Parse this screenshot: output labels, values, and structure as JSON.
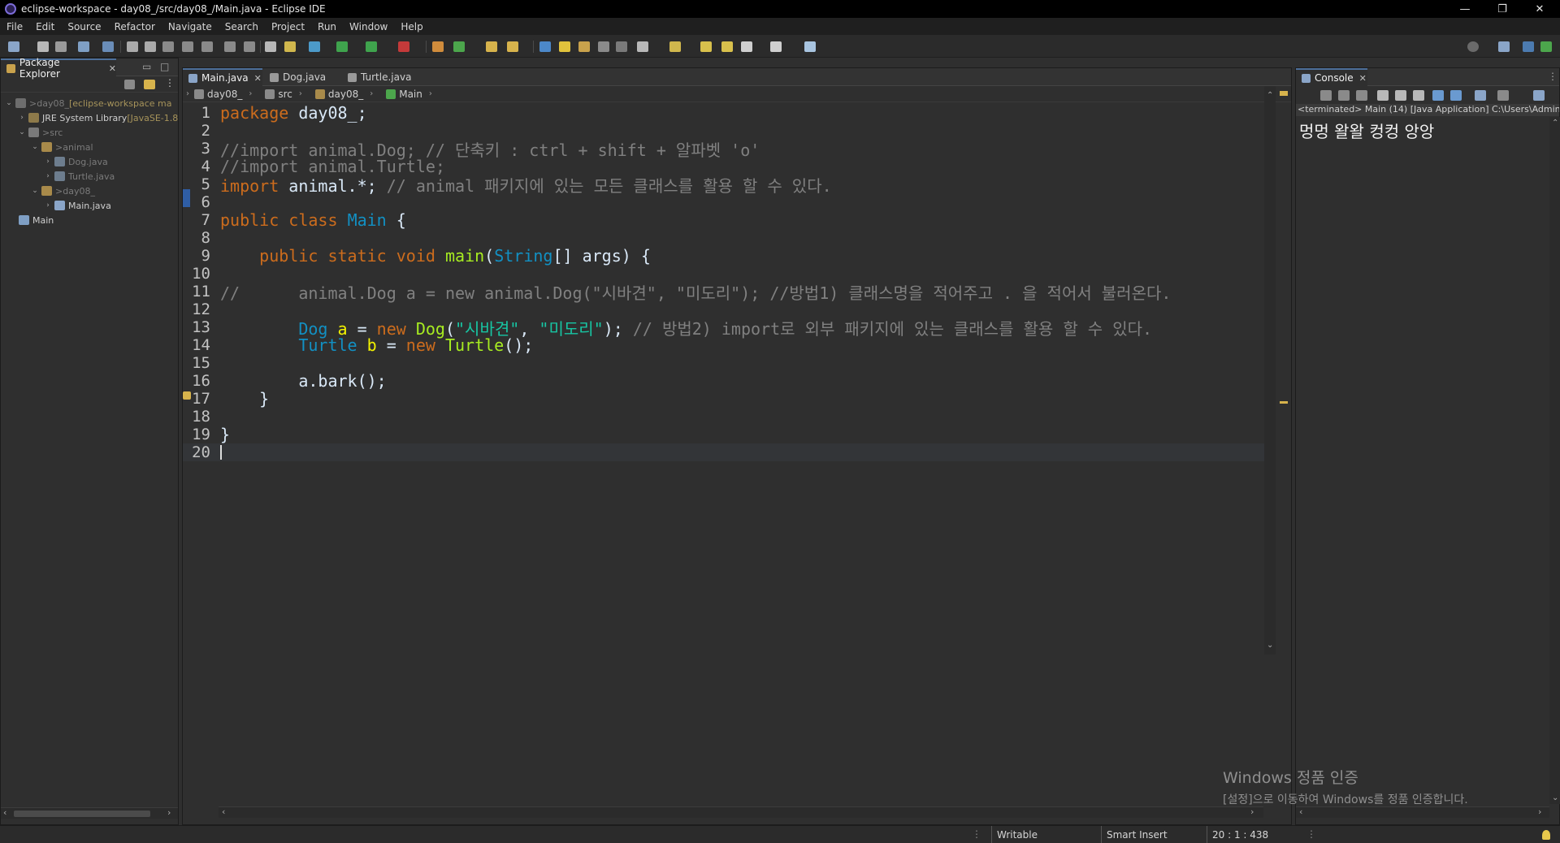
{
  "window": {
    "title": "eclipse-workspace - day08_/src/day08_/Main.java - Eclipse IDE",
    "minimize": "—",
    "restore": "❐",
    "close": "✕"
  },
  "menu": [
    "File",
    "Edit",
    "Source",
    "Refactor",
    "Navigate",
    "Search",
    "Project",
    "Run",
    "Window",
    "Help"
  ],
  "package_explorer": {
    "tab_label": "Package Explorer",
    "tree": [
      {
        "prefix": "> ",
        "label": "day08_",
        "suffix": " [eclipse-workspace ma",
        "twisty": "⌄"
      },
      {
        "prefix": "",
        "label": "JRE System Library",
        "suffix": " [JavaSE-1.8",
        "twisty": "›"
      },
      {
        "prefix": "> ",
        "label": "src",
        "suffix": "",
        "twisty": "⌄"
      },
      {
        "prefix": "> ",
        "label": "animal",
        "suffix": "",
        "twisty": "⌄"
      },
      {
        "prefix": "",
        "label": "Dog.java",
        "suffix": "",
        "twisty": "›"
      },
      {
        "prefix": "",
        "label": "Turtle.java",
        "suffix": "",
        "twisty": "›"
      },
      {
        "prefix": "> ",
        "label": "day08_",
        "suffix": "",
        "twisty": "⌄"
      },
      {
        "prefix": "",
        "label": "Main.java",
        "suffix": "",
        "twisty": "›"
      },
      {
        "prefix": "",
        "label": "Main",
        "suffix": "",
        "twisty": ""
      }
    ]
  },
  "editor": {
    "tabs": [
      {
        "label": "Main.java",
        "active": true
      },
      {
        "label": "Dog.java",
        "active": false
      },
      {
        "label": "Turtle.java",
        "active": false
      }
    ],
    "breadcrumb": [
      "day08_",
      "src",
      "day08_",
      "Main"
    ],
    "lines": [
      {
        "n": "1",
        "parts": [
          [
            "kw",
            "package"
          ],
          [
            "pl",
            " day08_;"
          ]
        ]
      },
      {
        "n": "2",
        "parts": []
      },
      {
        "n": "3",
        "parts": [
          [
            "cm",
            "//import animal.Dog; // 단축키 : ctrl + shift + 알파벳 'o'"
          ]
        ]
      },
      {
        "n": "4",
        "parts": [
          [
            "cm",
            "//import animal.Turtle;"
          ]
        ]
      },
      {
        "n": "5",
        "parts": [
          [
            "kw",
            "import"
          ],
          [
            "pl",
            " animal.*; "
          ],
          [
            "cm",
            "// animal 패키지에 있는 모든 클래스를 활용 할 수 있다."
          ]
        ]
      },
      {
        "n": "6",
        "parts": []
      },
      {
        "n": "7",
        "parts": [
          [
            "kw",
            "public"
          ],
          [
            "pl",
            " "
          ],
          [
            "kw",
            "class"
          ],
          [
            "pl",
            " "
          ],
          [
            "ty",
            "Main"
          ],
          [
            "pl",
            " {"
          ]
        ]
      },
      {
        "n": "8",
        "parts": []
      },
      {
        "n": "9",
        "parts": [
          [
            "pl",
            "    "
          ],
          [
            "kw",
            "public"
          ],
          [
            "pl",
            " "
          ],
          [
            "kw",
            "static"
          ],
          [
            "pl",
            " "
          ],
          [
            "kw",
            "void"
          ],
          [
            "pl",
            " "
          ],
          [
            "fn",
            "main"
          ],
          [
            "pl",
            "("
          ],
          [
            "ty",
            "String"
          ],
          [
            "pl",
            "[] "
          ],
          [
            "pl",
            "args) {"
          ]
        ]
      },
      {
        "n": "10",
        "parts": []
      },
      {
        "n": "11",
        "parts": [
          [
            "cm",
            "//      animal.Dog a = new animal.Dog(\"시바견\", \"미도리\"); //방법1) 클래스명을 적어주고 . 을 적어서 불러온다."
          ]
        ]
      },
      {
        "n": "12",
        "parts": []
      },
      {
        "n": "13",
        "parts": [
          [
            "pl",
            "        "
          ],
          [
            "ty",
            "Dog"
          ],
          [
            "pl",
            " "
          ],
          [
            "vr",
            "a"
          ],
          [
            "pl",
            " = "
          ],
          [
            "kw",
            "new"
          ],
          [
            "pl",
            " "
          ],
          [
            "fn",
            "Dog"
          ],
          [
            "pl",
            "("
          ],
          [
            "st",
            "\"시바견\""
          ],
          [
            "pl",
            ", "
          ],
          [
            "st",
            "\"미도리\""
          ],
          [
            "pl",
            "); "
          ],
          [
            "cm",
            "// 방법2) import로 외부 패키지에 있는 클래스를 활용 할 수 있다."
          ]
        ]
      },
      {
        "n": "14",
        "parts": [
          [
            "pl",
            "        "
          ],
          [
            "ty",
            "Turtle"
          ],
          [
            "pl",
            " "
          ],
          [
            "vr",
            "b"
          ],
          [
            "pl",
            " = "
          ],
          [
            "kw",
            "new"
          ],
          [
            "pl",
            " "
          ],
          [
            "fn",
            "Turtle"
          ],
          [
            "pl",
            "();"
          ]
        ]
      },
      {
        "n": "15",
        "parts": []
      },
      {
        "n": "16",
        "parts": [
          [
            "pl",
            "        a.bark();"
          ]
        ]
      },
      {
        "n": "17",
        "parts": [
          [
            "pl",
            "    }"
          ]
        ]
      },
      {
        "n": "18",
        "parts": []
      },
      {
        "n": "19",
        "parts": [
          [
            "pl",
            "}"
          ]
        ]
      },
      {
        "n": "20",
        "parts": []
      }
    ]
  },
  "console": {
    "tab_label": "Console",
    "header": "<terminated> Main (14) [Java Application] C:\\Users\\Admin",
    "output": "멍멍 왈왈 컹컹 앙앙"
  },
  "status": {
    "writable": "Writable",
    "insert_mode": "Smart Insert",
    "position": "20 : 1 : 438"
  },
  "watermark": {
    "line1": "Windows 정품 인증",
    "line2": "[설정]으로 이동하여 Windows를 정품 인증합니다."
  }
}
